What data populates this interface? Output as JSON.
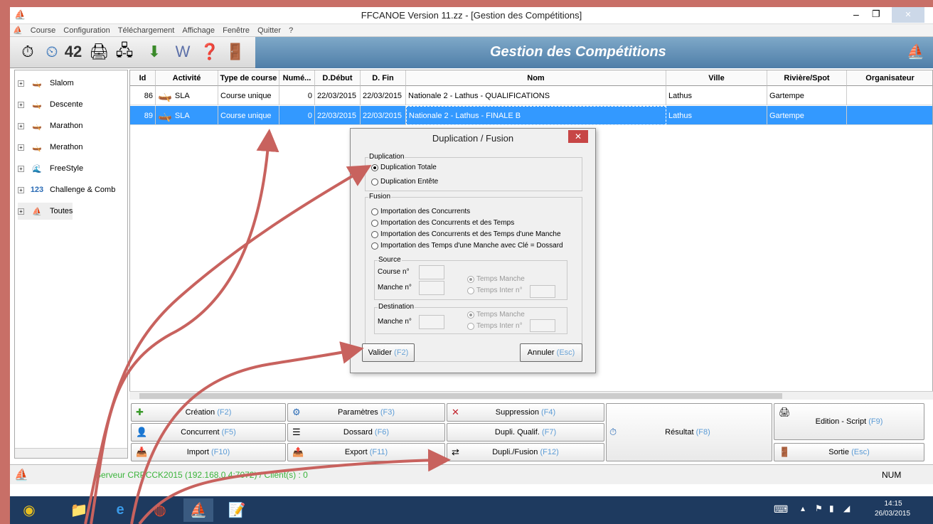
{
  "window": {
    "title": "FFCANOE Version 11.zz - [Gestion des Compétitions]"
  },
  "menu": [
    "Course",
    "Configuration",
    "Téléchargement",
    "Affichage",
    "Fenêtre",
    "Quitter",
    "?"
  ],
  "banner": {
    "title": "Gestion des Compétitions"
  },
  "tree": [
    {
      "label": "Slalom",
      "icon": "slalom-icon"
    },
    {
      "label": "Descente",
      "icon": "descente-icon"
    },
    {
      "label": "Marathon",
      "icon": "marathon-icon"
    },
    {
      "label": "Merathon",
      "icon": "marathon2-icon"
    },
    {
      "label": "FreeStyle",
      "icon": "freestyle-icon"
    },
    {
      "label": "Challenge & Comb",
      "icon": "challenge-icon"
    },
    {
      "label": "Toutes",
      "icon": "toutes-icon"
    }
  ],
  "grid": {
    "headers": [
      "Id",
      "Activité",
      "Type de course",
      "Numé...",
      "D.Début",
      "D. Fin",
      "Nom",
      "Ville",
      "Rivière/Spot",
      "Organisateur"
    ],
    "rows": [
      {
        "id": "86",
        "activite": "SLA",
        "type": "Course unique",
        "num": "0",
        "debut": "22/03/2015",
        "fin": "22/03/2015",
        "nom": "Nationale 2 - Lathus - QUALIFICATIONS",
        "ville": "Lathus",
        "riviere": "Gartempe",
        "org": ""
      },
      {
        "id": "89",
        "activite": "SLA",
        "type": "Course unique",
        "num": "0",
        "debut": "22/03/2015",
        "fin": "22/03/2015",
        "nom": "Nationale 2 - Lathus - FINALE B",
        "ville": "Lathus",
        "riviere": "Gartempe",
        "org": ""
      }
    ]
  },
  "buttons": {
    "creation": "Création",
    "creation_k": "(F2)",
    "parametres": "Paramètres",
    "parametres_k": "(F3)",
    "suppression": "Suppression",
    "suppression_k": "(F4)",
    "concurrent": "Concurrent",
    "concurrent_k": "(F5)",
    "dossard": "Dossard",
    "dossard_k": "(F6)",
    "dupli_qualif": "Dupli. Qualif.",
    "dupli_qualif_k": "(F7)",
    "resultat": "Résultat",
    "resultat_k": "(F8)",
    "edition": "Edition - Script",
    "edition_k": "(F9)",
    "import": "Import",
    "import_k": "(F10)",
    "export": "Export",
    "export_k": "(F11)",
    "dupli_fusion": "Dupli./Fusion",
    "dupli_fusion_k": "(F12)",
    "sortie": "Sortie",
    "sortie_k": "(Esc)"
  },
  "status": {
    "server": "Serveur CRPCCK2015 (192.168.0.4:7072) / Client(s) : 0",
    "num": "NUM"
  },
  "clock": {
    "time": "14:15",
    "date": "26/03/2015"
  },
  "dialog": {
    "title": "Duplication / Fusion",
    "duplication_legend": "Duplication",
    "dup_totale": "Duplication Totale",
    "dup_entete": "Duplication Entête",
    "fusion_legend": "Fusion",
    "fus1": "Importation des Concurrents",
    "fus2": "Importation des Concurrents et  des Temps",
    "fus3": "Importation des Concurrents et des Temps d'une Manche",
    "fus4": "Importation des Temps d'une Manche avec Clé = Dossard",
    "source_legend": "Source",
    "course_no": "Course n°",
    "manche_no": "Manche n°",
    "temps_manche": "Temps Manche",
    "temps_inter": "Temps Inter n°",
    "destination_legend": "Destination",
    "valider": "Valider",
    "valider_k": "(F2)",
    "annuler": "Annuler",
    "annuler_k": "(Esc)"
  }
}
